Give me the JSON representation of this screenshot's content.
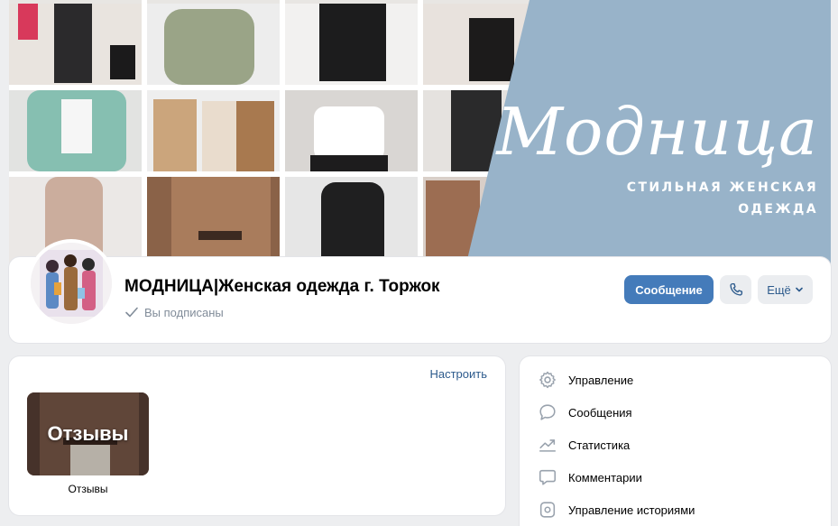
{
  "cover": {
    "brand_title": "Модница",
    "brand_subtitle_line1": "СТИЛЬНАЯ ЖЕНСКАЯ",
    "brand_subtitle_line2": "ОДЕЖДА",
    "panel_color": "#98b3c9"
  },
  "header": {
    "group_name": "МОДНИЦА|Женская одежда г. Торжок",
    "subscription_status": "Вы подписаны",
    "message_button": "Сообщение",
    "more_button": "Ещё"
  },
  "album_block": {
    "configure_link": "Настроить",
    "album_title_on_cover": "Отзывы",
    "album_caption": "Отзывы"
  },
  "admin_menu": {
    "items": [
      {
        "label": "Управление",
        "icon": "gear-icon"
      },
      {
        "label": "Сообщения",
        "icon": "chat-bubble-icon"
      },
      {
        "label": "Статистика",
        "icon": "trend-chart-icon"
      },
      {
        "label": "Комментарии",
        "icon": "comment-icon"
      },
      {
        "label": "Управление историями",
        "icon": "story-icon"
      }
    ]
  },
  "colors": {
    "accent": "#447bba",
    "link": "#2c5a8c",
    "muted_text": "#818c99",
    "background": "#edeef0"
  }
}
